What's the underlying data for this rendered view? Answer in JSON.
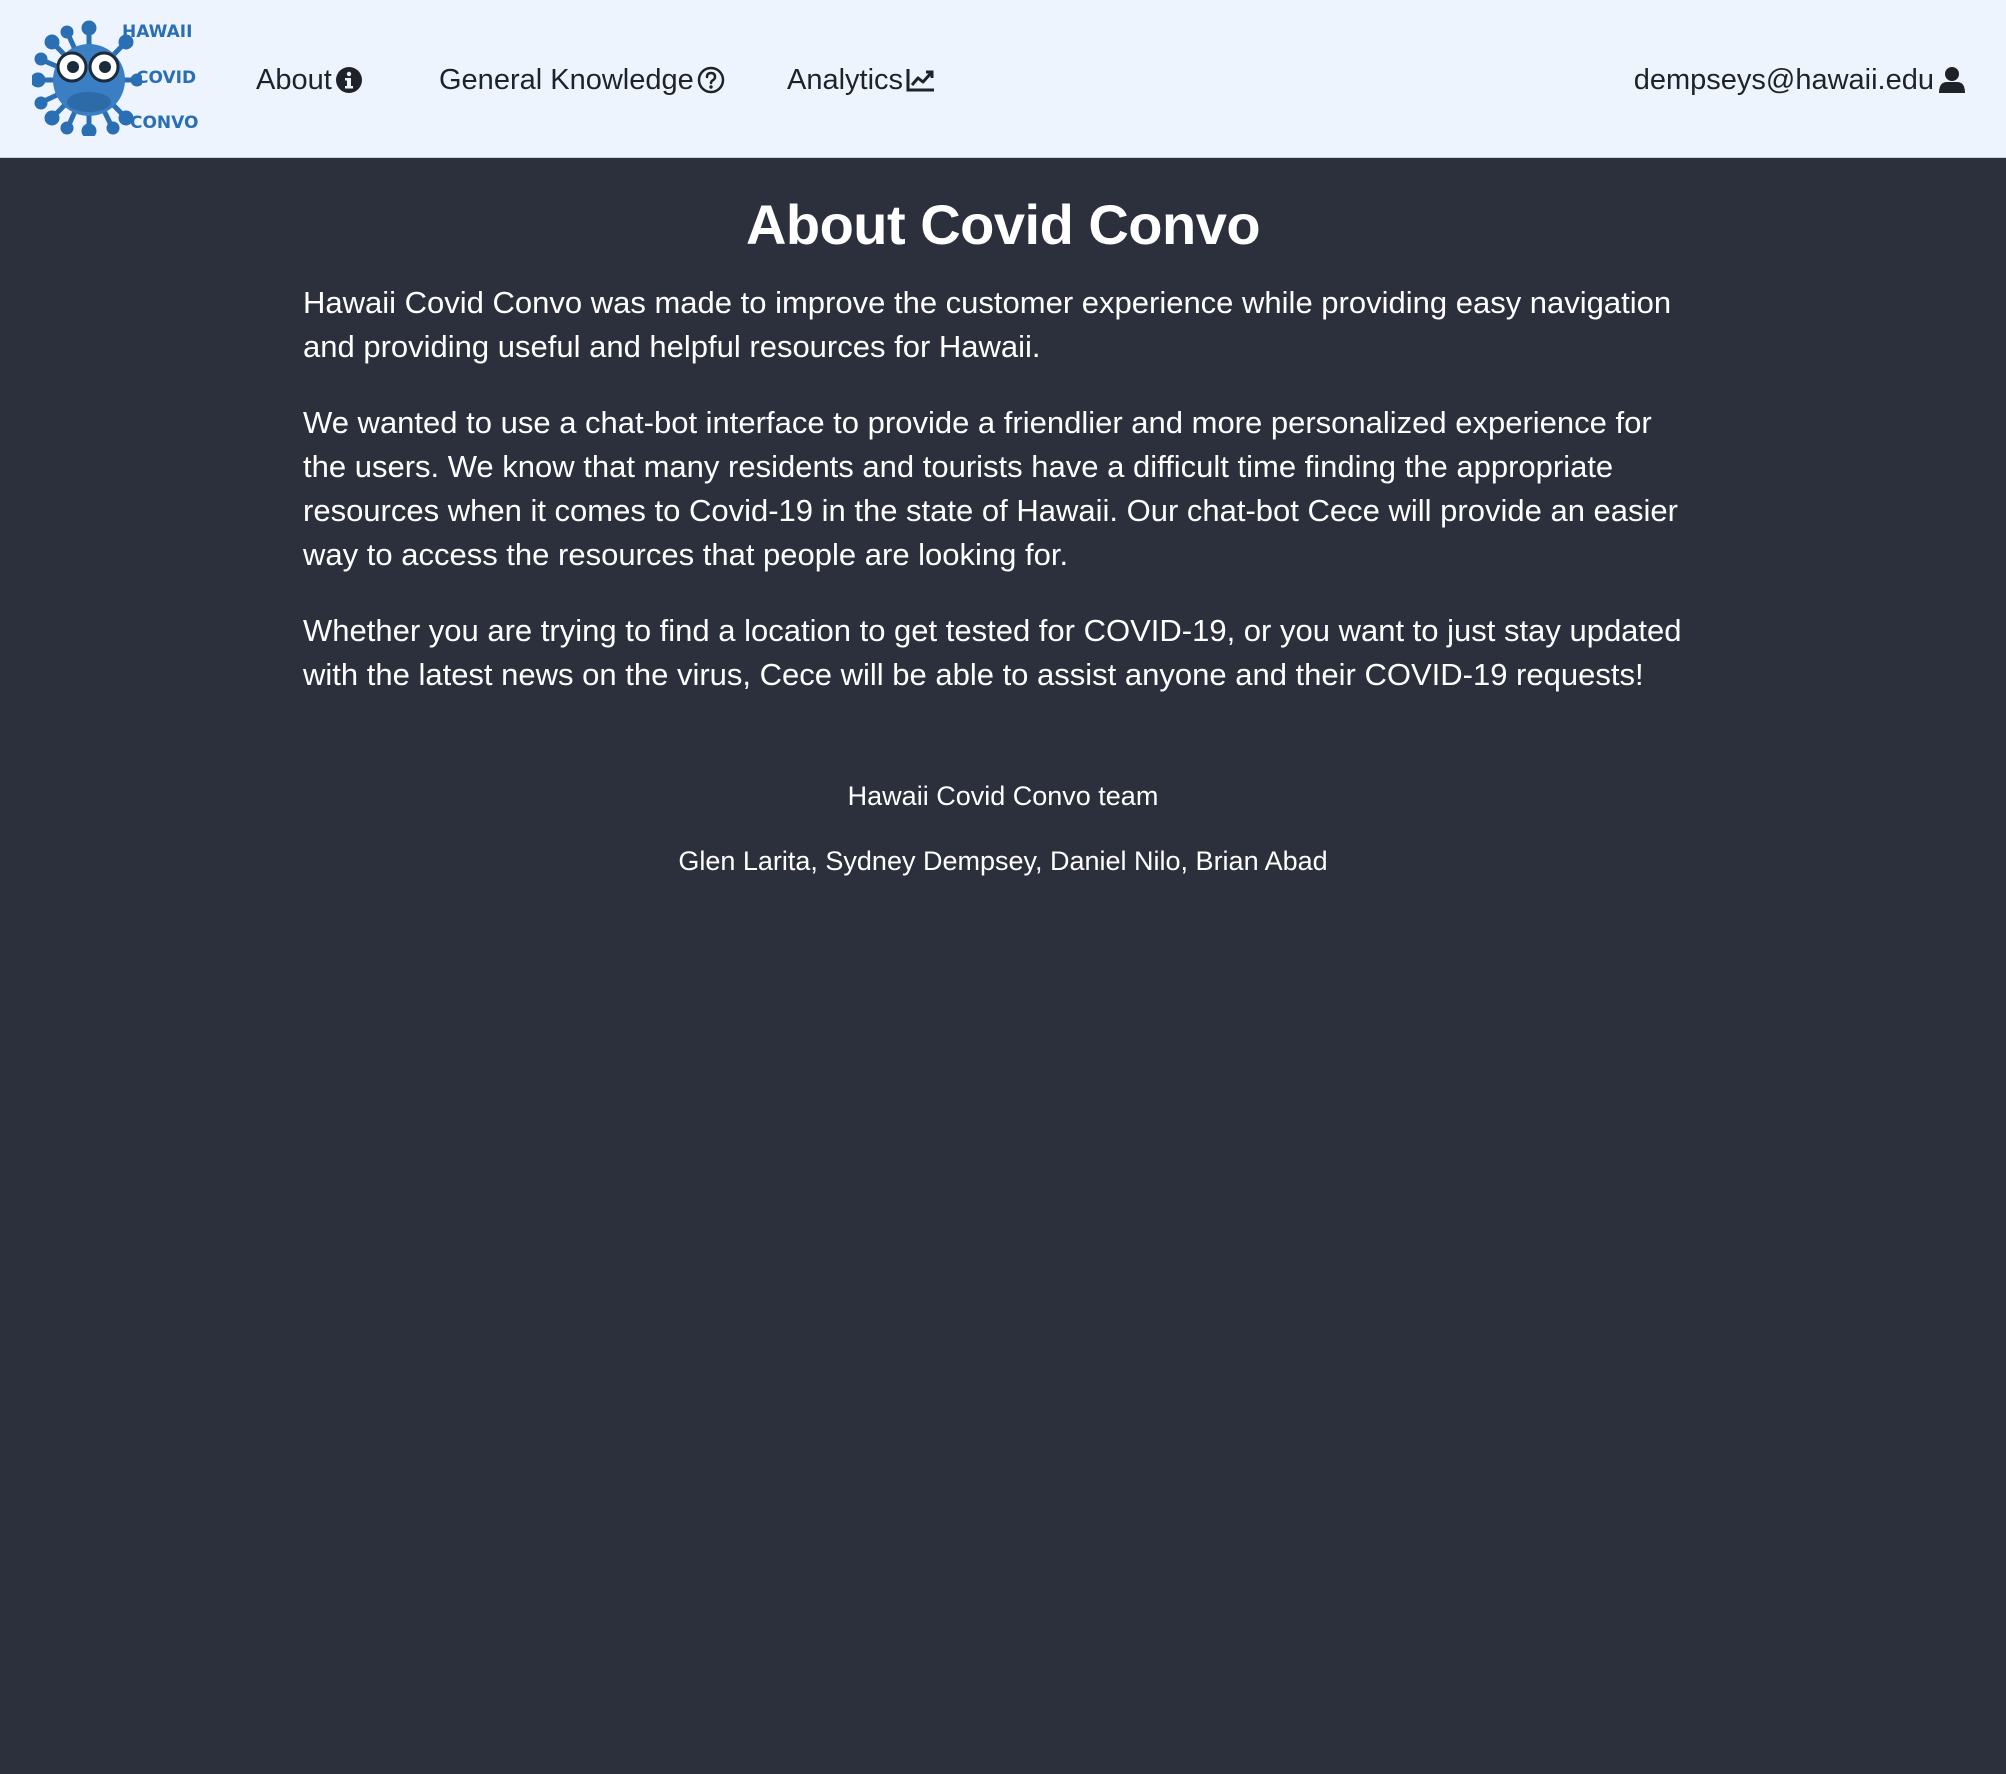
{
  "navbar": {
    "logo": {
      "line1": "HAWAII",
      "line2": "COVID",
      "line3": "CONVO",
      "icon": "virus-mascot-logo"
    },
    "items": [
      {
        "label": "About",
        "icon": "info-circle-icon"
      },
      {
        "label": "General Knowledge",
        "icon": "question-circle-icon"
      },
      {
        "label": "Analytics",
        "icon": "chart-line-icon"
      }
    ],
    "user": {
      "label": "dempseys@hawaii.edu",
      "icon": "user-icon"
    }
  },
  "main": {
    "title": "About Covid Convo",
    "paragraphs": [
      "Hawaii Covid Convo was made to improve the customer experience while providing easy navigation and providing useful and helpful resources for Hawaii.",
      "We wanted to use a chat-bot interface to provide a friendlier and more personalized experience for the users. We know that many residents and tourists have a difficult time finding the appropriate resources when it comes to Covid-19 in the state of Hawaii. Our chat-bot Cece will provide an easier way to access the resources that people are looking for.",
      "Whether you are trying to find a location to get tested for COVID-19, or you want to just stay updated with the latest news on the virus, Cece will be able to assist anyone and their COVID-19 requests!"
    ],
    "team_title": "Hawaii Covid Convo team",
    "team_members": "Glen Larita, Sydney Dempsey, Daniel Nilo, Brian Abad"
  },
  "colors": {
    "navbar_bg": "#eef4fd",
    "page_bg": "#2b303c",
    "logo_blue": "#2a6fb3",
    "text_dark": "#1f2329",
    "text_light": "#ffffff"
  }
}
